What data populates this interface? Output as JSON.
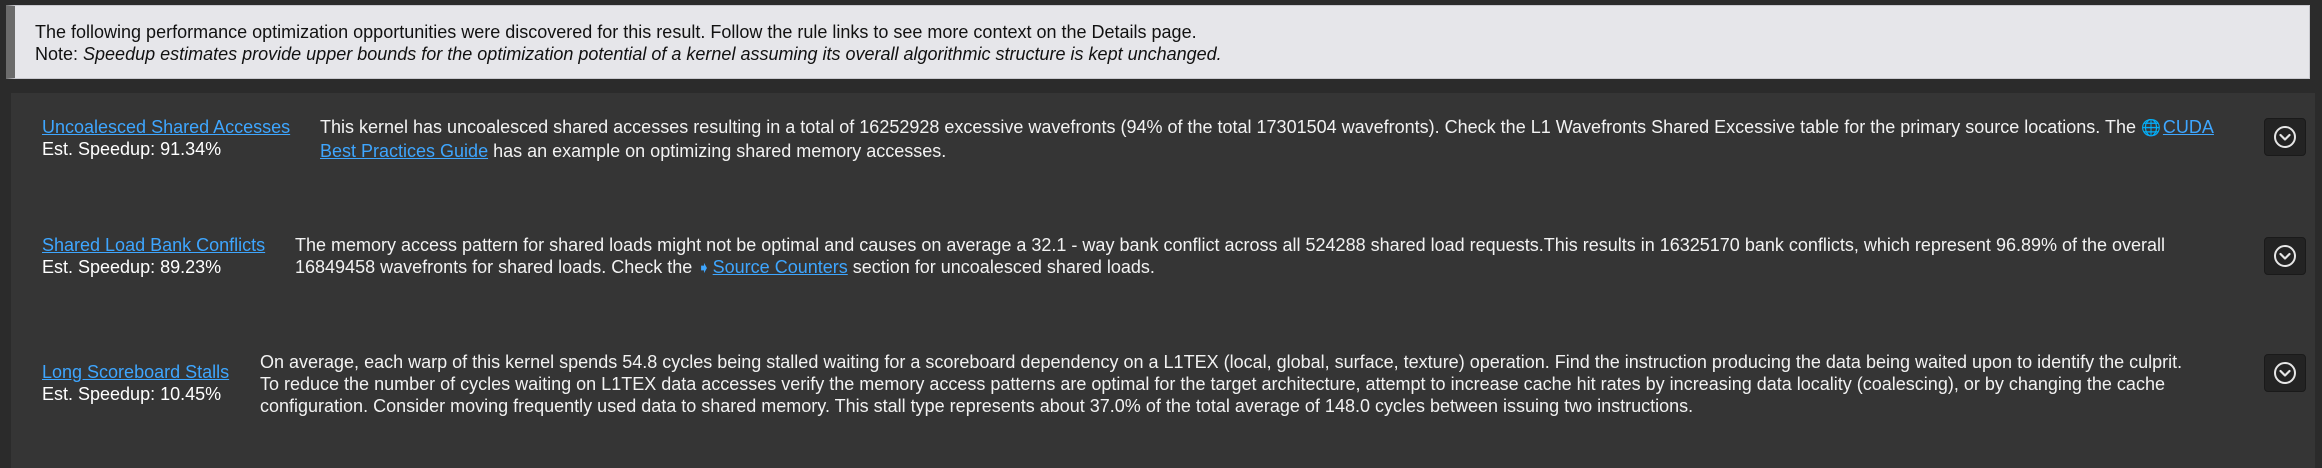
{
  "notice": {
    "line1": "The following performance optimization opportunities were discovered for this result. Follow the rule links to see more context on the Details page.",
    "note_label": "Note: ",
    "note_text": "Speedup estimates provide upper bounds for the optimization potential of a kernel assuming its overall algorithmic structure is kept unchanged."
  },
  "rules": [
    {
      "link": "Uncoalesced Shared Accesses",
      "speedup": "Est. Speedup: 91.34%",
      "text_before": "This kernel has uncoalesced shared accesses resulting in a total of 16252928 excessive wavefronts (94% of the total 17301504 wavefronts). Check the L1 Wavefronts Shared Excessive table for the primary source locations. The ",
      "link_text": "CUDA Best Practices Guide",
      "link_icon": "globe-icon",
      "text_after": " has an example on optimizing shared memory accesses."
    },
    {
      "link": "Shared Load Bank Conflicts",
      "speedup": "Est. Speedup: 89.23%",
      "text_before": "The memory access pattern for shared loads might not be optimal and causes on average a 32.1 - way bank conflict across all 524288 shared load requests.This results in 16325170 bank conflicts, which represent 96.89% of the overall 16849458 wavefronts for shared loads. Check the ",
      "link_text": "Source Counters",
      "link_icon": "arrow-right-icon",
      "text_after": " section for uncoalesced shared loads."
    },
    {
      "link": "Long Scoreboard Stalls",
      "speedup": "Est. Speedup: 10.45%",
      "text": "On average, each warp of this kernel spends 54.8 cycles being stalled waiting for a scoreboard dependency on a L1TEX (local, global, surface, texture) operation. Find the instruction producing the data being waited upon to identify the culprit. To reduce the number of cycles waiting on L1TEX data accesses verify the memory access patterns are optimal for the target architecture, attempt to increase cache hit rates by increasing data locality (coalescing), or by changing the cache configuration. Consider moving frequently used data to shared memory. This stall type represents about 37.0% of the total average of 148.0 cycles between issuing two instructions."
    }
  ],
  "colors": {
    "link": "#3ea6ff",
    "panel": "#353535",
    "notice_bg": "#e6e6ea"
  }
}
